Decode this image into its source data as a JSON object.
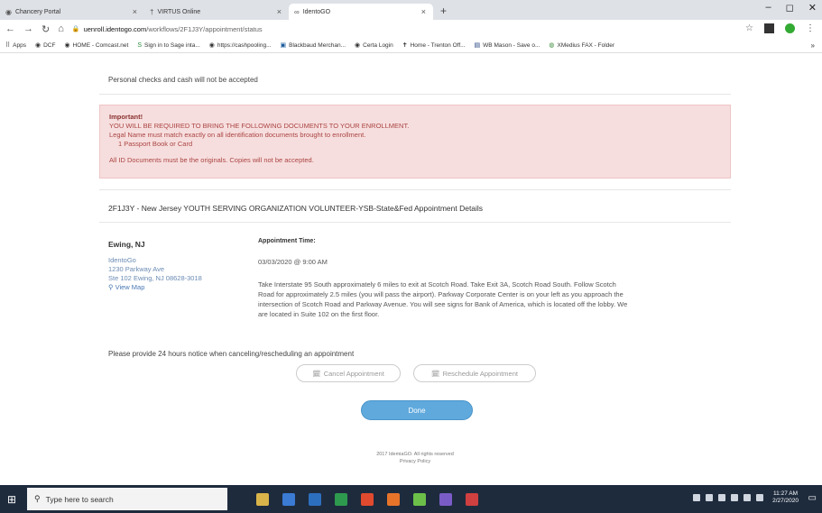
{
  "browser": {
    "tabs": [
      {
        "label": "Chancery Portal",
        "icon": "globe-icon"
      },
      {
        "label": "VIRTUS Online",
        "icon": "cross-icon"
      },
      {
        "label": "IdentoGO",
        "icon": "infinity-icon"
      }
    ],
    "url_host": "uenroll.identogo.com",
    "url_path": "/workflows/2F1J3Y/appointment/status",
    "bookmarks": [
      "Apps",
      "DCF",
      "HOME - Comcast.net",
      "Sign in to Sage inta...",
      "https://cashpooling...",
      "Blackbaud Merchan...",
      "Certa Login",
      "Home - Trenton Off...",
      "WB Mason - Save o...",
      "XMedius FAX - Folder"
    ]
  },
  "page": {
    "notice_top": "Personal checks and cash will not be accepted",
    "important": {
      "title": "Important!",
      "line1": "YOU WILL BE REQUIRED TO BRING THE FOLLOWING DOCUMENTS TO YOUR ENROLLMENT.",
      "line2": "Legal Name must match exactly on all identification documents brought to enrollment.",
      "item1": "1  Passport Book or Card",
      "line3": "All ID Documents must be the originals. Copies will not be accepted."
    },
    "details_title": "2F1J3Y - New Jersey YOUTH SERVING ORGANIZATION VOLUNTEER-YSB-State&Fed Appointment Details",
    "location": {
      "city": "Ewing, NJ",
      "name": "IdentoGo",
      "street": "1230 Parkway Ave",
      "suite": "Ste 102 Ewing, NJ 08628-3018",
      "map_link": "View Map"
    },
    "appointment": {
      "label": "Appointment Time:",
      "time": "03/03/2020 @ 9:00 AM",
      "directions": "Take Interstate 95 South approximately 6 miles to exit at Scotch Road. Take Exit 3A, Scotch Road South. Follow Scotch Road for approximately 2.5 miles (you will pass the airport). Parkway Corporate Center is on your left as you approach the intersection of Scotch Road and Parkway Avenue. You will see signs for Bank of America, which is located off the lobby. We are located in Suite 102 on the first floor."
    },
    "cancel_note": "Please provide 24 hours notice when canceling/rescheduling an appointment",
    "buttons": {
      "cancel": "Cancel Appointment",
      "reschedule": "Reschedule Appointment",
      "done": "Done"
    },
    "footer_line1": "2017 IdemiaGO. All rights reserved",
    "footer_line2": "Privacy Policy"
  },
  "taskbar": {
    "search_placeholder": "Type here to search",
    "time": "11:27 AM",
    "date": "2/27/2020",
    "app_colors": [
      "#d9b44a",
      "#3b7bd4",
      "#2d6fbf",
      "#2e9a4e",
      "#e04a2f",
      "#e8742a",
      "#6cc04a",
      "#7a5cc7",
      "#d04040"
    ]
  }
}
